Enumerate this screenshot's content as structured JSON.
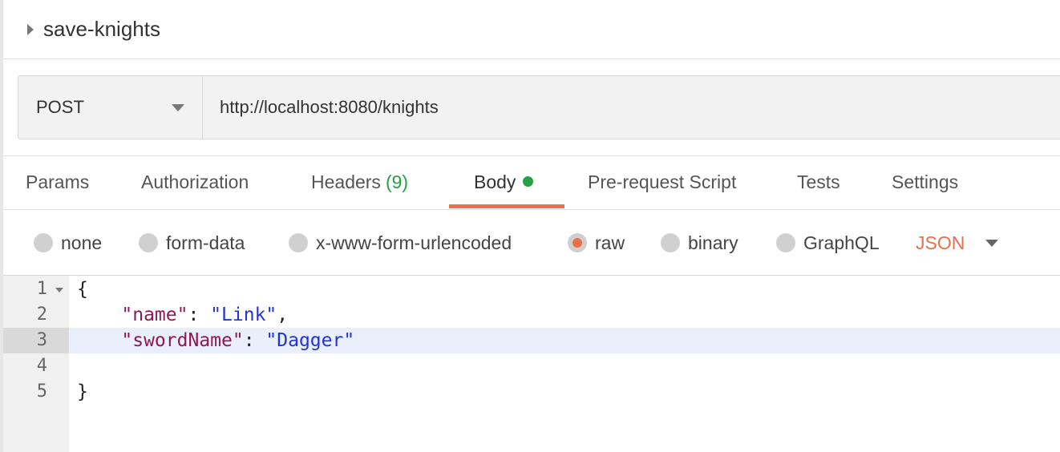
{
  "request": {
    "name": "save-knights",
    "method": "POST",
    "url": "http://localhost:8080/knights"
  },
  "tabs": [
    {
      "label": "Params"
    },
    {
      "label": "Authorization"
    },
    {
      "label": "Headers",
      "count": "(9)"
    },
    {
      "label": "Body",
      "active": true
    },
    {
      "label": "Pre-request Script"
    },
    {
      "label": "Tests"
    },
    {
      "label": "Settings"
    }
  ],
  "body_types": [
    {
      "label": "none"
    },
    {
      "label": "form-data"
    },
    {
      "label": "x-www-form-urlencoded"
    },
    {
      "label": "raw",
      "selected": true
    },
    {
      "label": "binary"
    },
    {
      "label": "GraphQL"
    }
  ],
  "format": {
    "selected": "JSON"
  },
  "editor": {
    "line_numbers": [
      "1",
      "2",
      "3",
      "4",
      "5"
    ],
    "active_line": 3,
    "lines": {
      "l1": "{",
      "key_name": "\"name\"",
      "val_name": "\"Link\"",
      "key_sword": "\"swordName\"",
      "val_sword": "\"Dagger\"",
      "l5": "}"
    }
  },
  "colors": {
    "accent": "#e8704b",
    "success": "#26a045",
    "json_key": "#8c1a56",
    "json_string": "#2233d6"
  }
}
